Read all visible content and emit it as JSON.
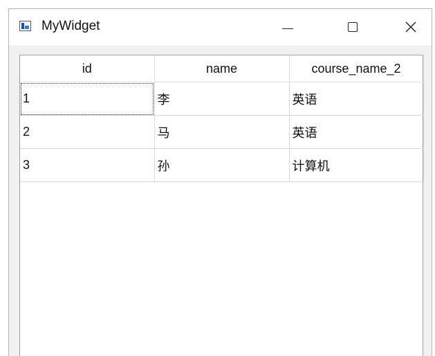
{
  "window": {
    "title": "MyWidget",
    "controls": {
      "minimize_glyph": "—",
      "close_glyph": "✕"
    }
  },
  "table": {
    "headers": [
      "id",
      "name",
      "course_name_2"
    ],
    "rows": [
      [
        "1",
        "李",
        "英语"
      ],
      [
        "2",
        "马",
        "英语"
      ],
      [
        "3",
        "孙",
        "计算机"
      ]
    ]
  },
  "colors": {
    "window_bg": "#f0f0f0",
    "titlebar_bg": "#ffffff",
    "grid_line": "#d8d8d8"
  }
}
